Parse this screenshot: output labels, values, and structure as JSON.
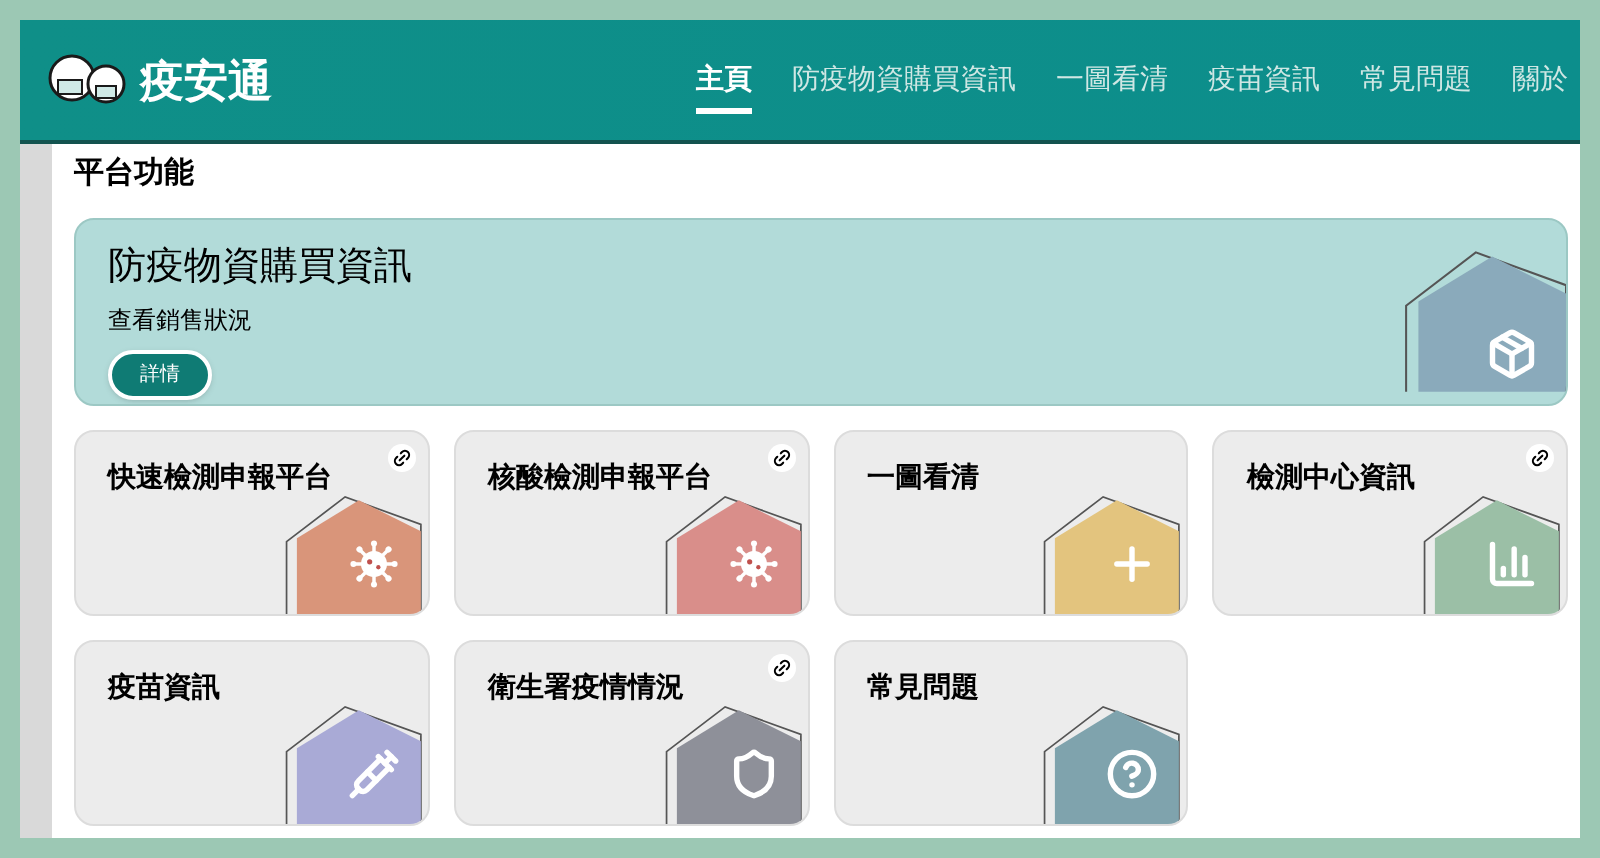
{
  "header": {
    "logo_text": "疫安通",
    "nav": [
      {
        "label": "主頁",
        "selected": true
      },
      {
        "label": "防疫物資購買資訊",
        "selected": false
      },
      {
        "label": "一圖看清",
        "selected": false
      },
      {
        "label": "疫苗資訊",
        "selected": false
      },
      {
        "label": "常見問題",
        "selected": false
      },
      {
        "label": "關於",
        "selected": false
      }
    ]
  },
  "section_title": "平台功能",
  "banner": {
    "title": "防疫物資購買資訊",
    "subtitle": "查看銷售狀況",
    "button": "詳情",
    "kind": "box",
    "color": "#8aaabb"
  },
  "cards": [
    {
      "title": "快速檢測申報平台",
      "kind": "virus",
      "color": "#d9957a",
      "link": true
    },
    {
      "title": "核酸檢測申報平台",
      "kind": "virus",
      "color": "#d98e8a",
      "link": true
    },
    {
      "title": "一圖看清",
      "kind": "plus",
      "color": "#e3c47e",
      "link": false
    },
    {
      "title": "檢測中心資訊",
      "kind": "chart",
      "color": "#9bbfa6",
      "link": true
    },
    {
      "title": "疫苗資訊",
      "kind": "syringe",
      "color": "#a9aad6",
      "link": false
    },
    {
      "title": "衛生署疫情情況",
      "kind": "shield",
      "color": "#8e9099",
      "link": true
    },
    {
      "title": "常見問題",
      "kind": "question",
      "color": "#7fa3ad",
      "link": false
    }
  ]
}
